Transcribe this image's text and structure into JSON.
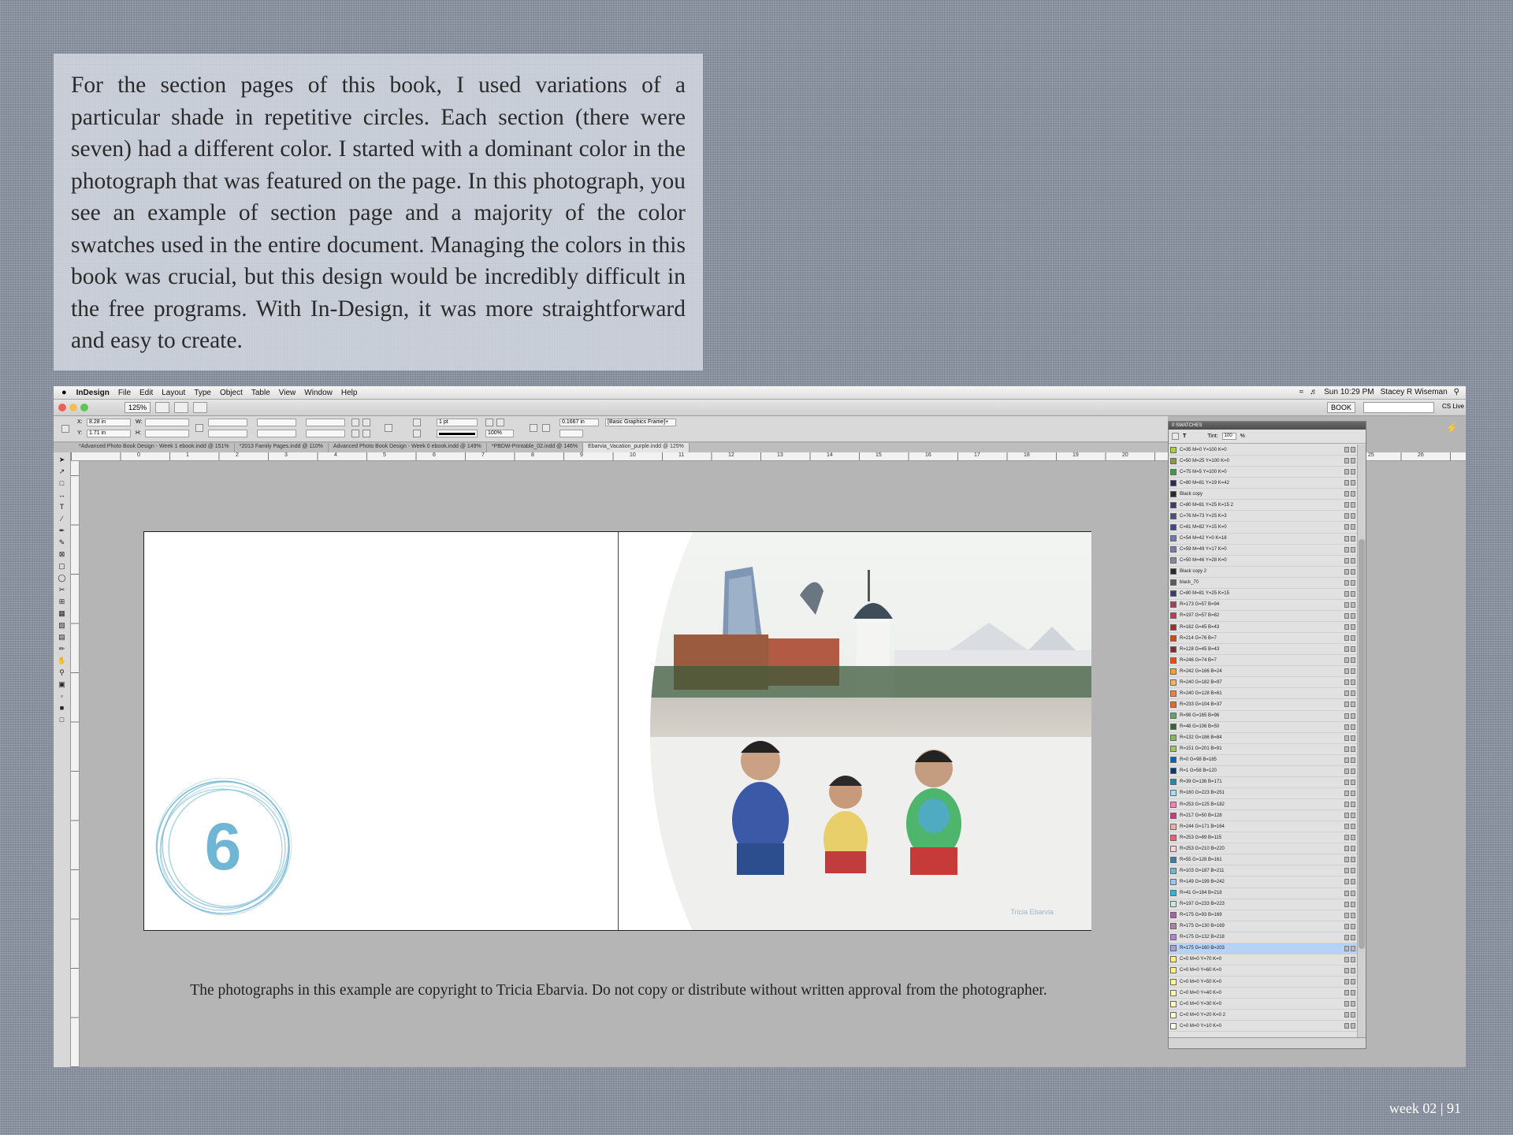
{
  "intro_text": "For the section pages of this book, I used variations of a particular shade in repetitive circles. Each section (there were seven) had a different color. I started with a dominant color in the photograph that was featured on the page. In this photograph, you see an example of section page and a majority of the color swatches used in the entire document. Managing the colors in this book was crucial, but this design would be incredibly difficult in the free programs. With In-Design, it was more straightforward and easy to create.",
  "menubar": {
    "apple": "",
    "items": [
      "InDesign",
      "File",
      "Edit",
      "Layout",
      "Type",
      "Object",
      "Table",
      "View",
      "Window",
      "Help"
    ],
    "clock": "Sun 10:29 PM",
    "user": "Stacey R Wiseman"
  },
  "titlebar": {
    "zoom": "125%",
    "book": "BOOK",
    "cs_live": "CS Live"
  },
  "control": {
    "x": "8.28 in",
    "y": "1.71 in",
    "stroke": "1 pt",
    "frame_style": "[Basic Graphics Frame]+",
    "gap": "0.1667 in",
    "opacity": "100%"
  },
  "tabs": [
    "*Advanced Photo Book Design - Week 1 ebook.indd @ 151%",
    "*2013 Family Pages.indd @ 110%",
    "Advanced Photo Book Design - Week 0 ebook.indd @ 149%",
    "*PBDW-Printable_02.indd @ 146%",
    "Ebarvia_Vacation_purple.indd @ 125%"
  ],
  "ruler_numbers": [
    "0",
    "1",
    "2",
    "3",
    "4",
    "5",
    "6",
    "7",
    "8",
    "9",
    "10",
    "11",
    "12",
    "13",
    "14",
    "15",
    "16",
    "17",
    "18",
    "19",
    "20",
    "21",
    "22",
    "23",
    "24",
    "25",
    "26"
  ],
  "section_number": "6",
  "photo_watermark": "Tricia Ebarvia",
  "copyright": "The photographs in this example are copyright to Tricia Ebarvia. Do not copy or distribute without written approval from the photographer.",
  "swatches": {
    "title": "0 SWATCHES",
    "tint_label": "Tint:",
    "tint_value": "100",
    "tint_unit": "%",
    "selected_index": 45,
    "items": [
      {
        "name": "C=35 M=0 Y=100 K=0",
        "color": "#a9cf3a"
      },
      {
        "name": "C=50 M=25 Y=100 K=0",
        "color": "#8a9b3c"
      },
      {
        "name": "C=75 M=5 Y=100 K=0",
        "color": "#3d9c3f"
      },
      {
        "name": "C=80 M=81 Y=19 K=42",
        "color": "#2e2a55"
      },
      {
        "name": "Black copy",
        "color": "#2a2a2a"
      },
      {
        "name": "C=80 M=81 Y=25 K=15 2",
        "color": "#3d3a72"
      },
      {
        "name": "C=76 M=73 Y=25 K=3",
        "color": "#4a4d87"
      },
      {
        "name": "C=81 M=82 Y=15 K=0",
        "color": "#4a438f"
      },
      {
        "name": "C=54 M=42 Y=0 K=18",
        "color": "#6c7aac"
      },
      {
        "name": "C=59 M=49 Y=17 K=0",
        "color": "#737ba9"
      },
      {
        "name": "C=50 M=46 Y=28 K=0",
        "color": "#8a8597"
      },
      {
        "name": "Black copy 2",
        "color": "#2a2a2a"
      },
      {
        "name": "black_70",
        "color": "#5a5a5a"
      },
      {
        "name": "C=80 M=81 Y=25 K=15",
        "color": "#3d3a72"
      },
      {
        "name": "R=173 G=57 B=94",
        "color": "#ad395e"
      },
      {
        "name": "R=197 G=57 B=82",
        "color": "#c53952"
      },
      {
        "name": "R=162 G=45 B=43",
        "color": "#a22d2b"
      },
      {
        "name": "R=214 G=76 B=7",
        "color": "#d64c07"
      },
      {
        "name": "R=128 G=45 B=43",
        "color": "#802d2b"
      },
      {
        "name": "R=246 G=74 B=7",
        "color": "#f64a07"
      },
      {
        "name": "R=242 G=166 B=24",
        "color": "#f2a618"
      },
      {
        "name": "R=240 G=182 B=97",
        "color": "#f0b661"
      },
      {
        "name": "R=240 G=128 B=61",
        "color": "#f0803d"
      },
      {
        "name": "R=233 G=104 B=37",
        "color": "#e96825"
      },
      {
        "name": "R=98 G=165 B=96",
        "color": "#62a560"
      },
      {
        "name": "R=48 G=106 B=50",
        "color": "#306a32"
      },
      {
        "name": "R=132 G=186 B=84",
        "color": "#84ba54"
      },
      {
        "name": "R=151 G=201 B=91",
        "color": "#97c95b"
      },
      {
        "name": "R=0 G=98 B=185",
        "color": "#0062b9"
      },
      {
        "name": "R=1 G=56 B=120",
        "color": "#013878"
      },
      {
        "name": "R=39 G=136 B=171",
        "color": "#2788ab"
      },
      {
        "name": "R=160 G=223 B=251",
        "color": "#a0dffb"
      },
      {
        "name": "R=253 G=125 B=182",
        "color": "#fd7db6"
      },
      {
        "name": "R=217 G=50 B=128",
        "color": "#d93280"
      },
      {
        "name": "R=244 G=171 B=164",
        "color": "#f4aba4"
      },
      {
        "name": "R=253 G=89 B=115",
        "color": "#fd5973"
      },
      {
        "name": "R=253 G=210 B=220",
        "color": "#fdd2dc"
      },
      {
        "name": "R=55 G=128 B=161",
        "color": "#3780a1"
      },
      {
        "name": "R=103 G=187 B=211",
        "color": "#67bbd3"
      },
      {
        "name": "R=149 G=199 B=242",
        "color": "#95c7f2"
      },
      {
        "name": "R=41 G=184 B=218",
        "color": "#29b8da"
      },
      {
        "name": "R=197 G=233 B=223",
        "color": "#c5e9df"
      },
      {
        "name": "R=175 G=93 B=169",
        "color": "#af5da9"
      },
      {
        "name": "R=175 G=130 B=169",
        "color": "#af82a9"
      },
      {
        "name": "R=175 G=132 B=218",
        "color": "#af84da"
      },
      {
        "name": "R=175 G=160 B=203",
        "color": "#afa0cb"
      },
      {
        "name": "C=0 M=0 Y=70 K=0",
        "color": "#fff46a"
      },
      {
        "name": "C=0 M=0 Y=60 K=0",
        "color": "#fff67f"
      },
      {
        "name": "C=0 M=0 Y=50 K=0",
        "color": "#fff893"
      },
      {
        "name": "C=0 M=0 Y=40 K=0",
        "color": "#fffaa7"
      },
      {
        "name": "C=0 M=0 Y=30 K=0",
        "color": "#fffbbb"
      },
      {
        "name": "C=0 M=0 Y=20 K=0 2",
        "color": "#fffcd0"
      },
      {
        "name": "C=0 M=0 Y=10 K=0",
        "color": "#fffee6"
      }
    ]
  },
  "page_number": "week 02 | 91",
  "colors": {
    "circle_accent": "#6fb6d6",
    "pasteboard": "#b5b5b5",
    "linen": "#8e97a6"
  }
}
